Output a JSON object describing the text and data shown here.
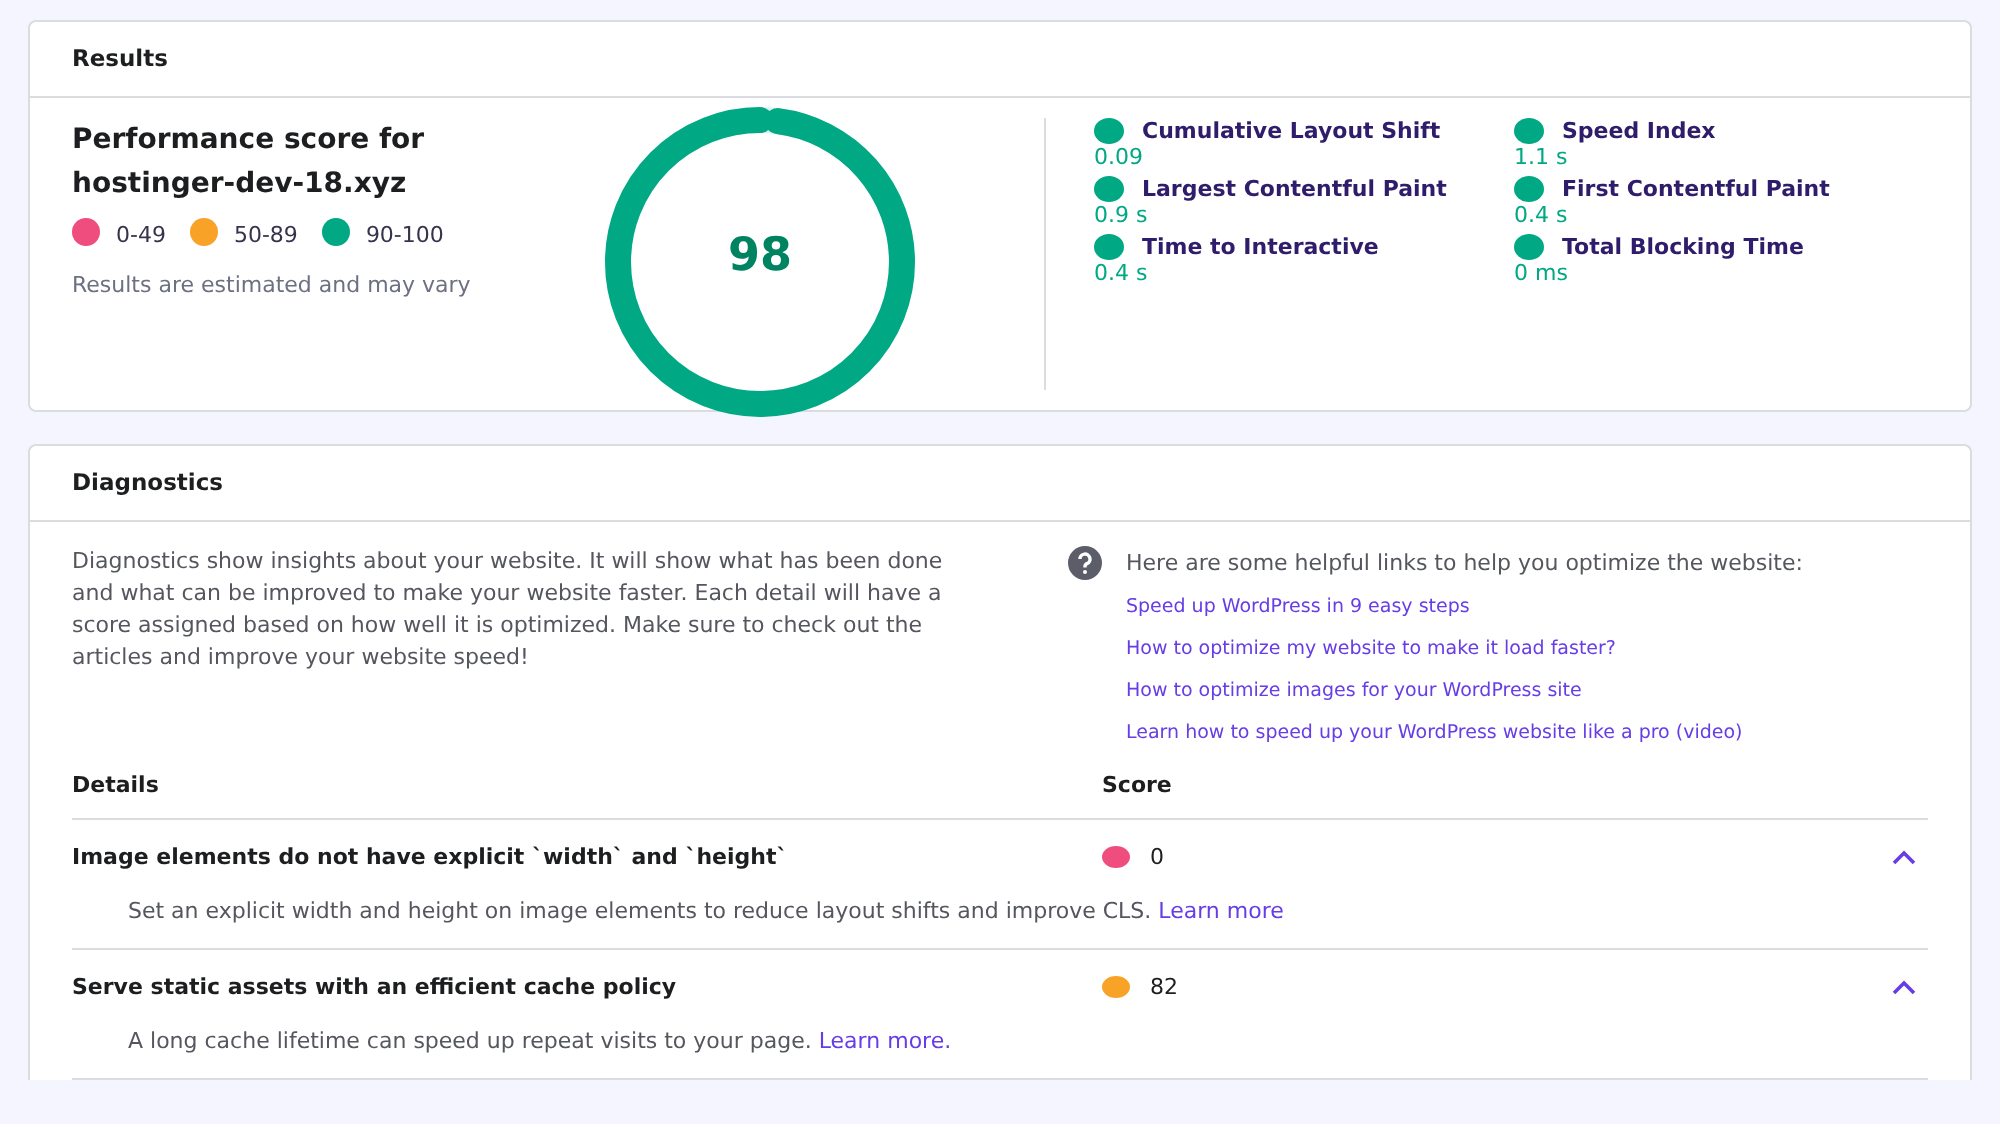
{
  "results": {
    "title": "Results",
    "heading": "Performance score for hostinger-dev-18.xyz",
    "legend": [
      {
        "label": "0-49",
        "color": "#ee4d7e"
      },
      {
        "label": "50-89",
        "color": "#f8a227"
      },
      {
        "label": "90-100",
        "color": "#00a884"
      }
    ],
    "note": "Results are estimated and may vary",
    "score": {
      "value": "98",
      "level": 0.98
    },
    "metrics": [
      {
        "name": "Cumulative Layout Shift",
        "value": "0.09",
        "color": "#00a884"
      },
      {
        "name": "Speed Index",
        "value": "1.1 s",
        "color": "#00a884"
      },
      {
        "name": "Largest Contentful Paint",
        "value": "0.9 s",
        "color": "#00a884"
      },
      {
        "name": "First Contentful Paint",
        "value": "0.4 s",
        "color": "#00a884"
      },
      {
        "name": "Time to Interactive",
        "value": "0.4 s",
        "color": "#00a884"
      },
      {
        "name": "Total Blocking Time",
        "value": "0 ms",
        "color": "#00a884"
      }
    ]
  },
  "diagnostics": {
    "title": "Diagnostics",
    "intro": "Diagnostics show insights about your website. It will show what has been done and what can be improved to make your website faster. Each detail will have a score assigned based on how well it is optimized. Make sure to check out the articles and improve your website speed!",
    "links_heading": "Here are some helpful links to help you optimize the website:",
    "links": [
      "Speed up WordPress in 9 easy steps",
      "How to optimize my website to make it load faster?",
      "How to optimize images for your WordPress site",
      "Learn how to speed up your WordPress website like a pro (video)"
    ],
    "columns": [
      "Details",
      "Score"
    ],
    "audits": [
      {
        "title": "Image elements do not have explicit `width` and `height`",
        "score": "0",
        "color": "#ee4d7e",
        "expanded": true,
        "description": "Set an explicit width and height on image elements to reduce layout shifts and improve CLS.",
        "link": "Learn more"
      },
      {
        "title": "Serve static assets with an efficient cache policy",
        "score": "82",
        "color": "#f8a227",
        "expanded": true,
        "description": "A long cache lifetime can speed up repeat visits to your page.",
        "link": "Learn more."
      }
    ]
  }
}
